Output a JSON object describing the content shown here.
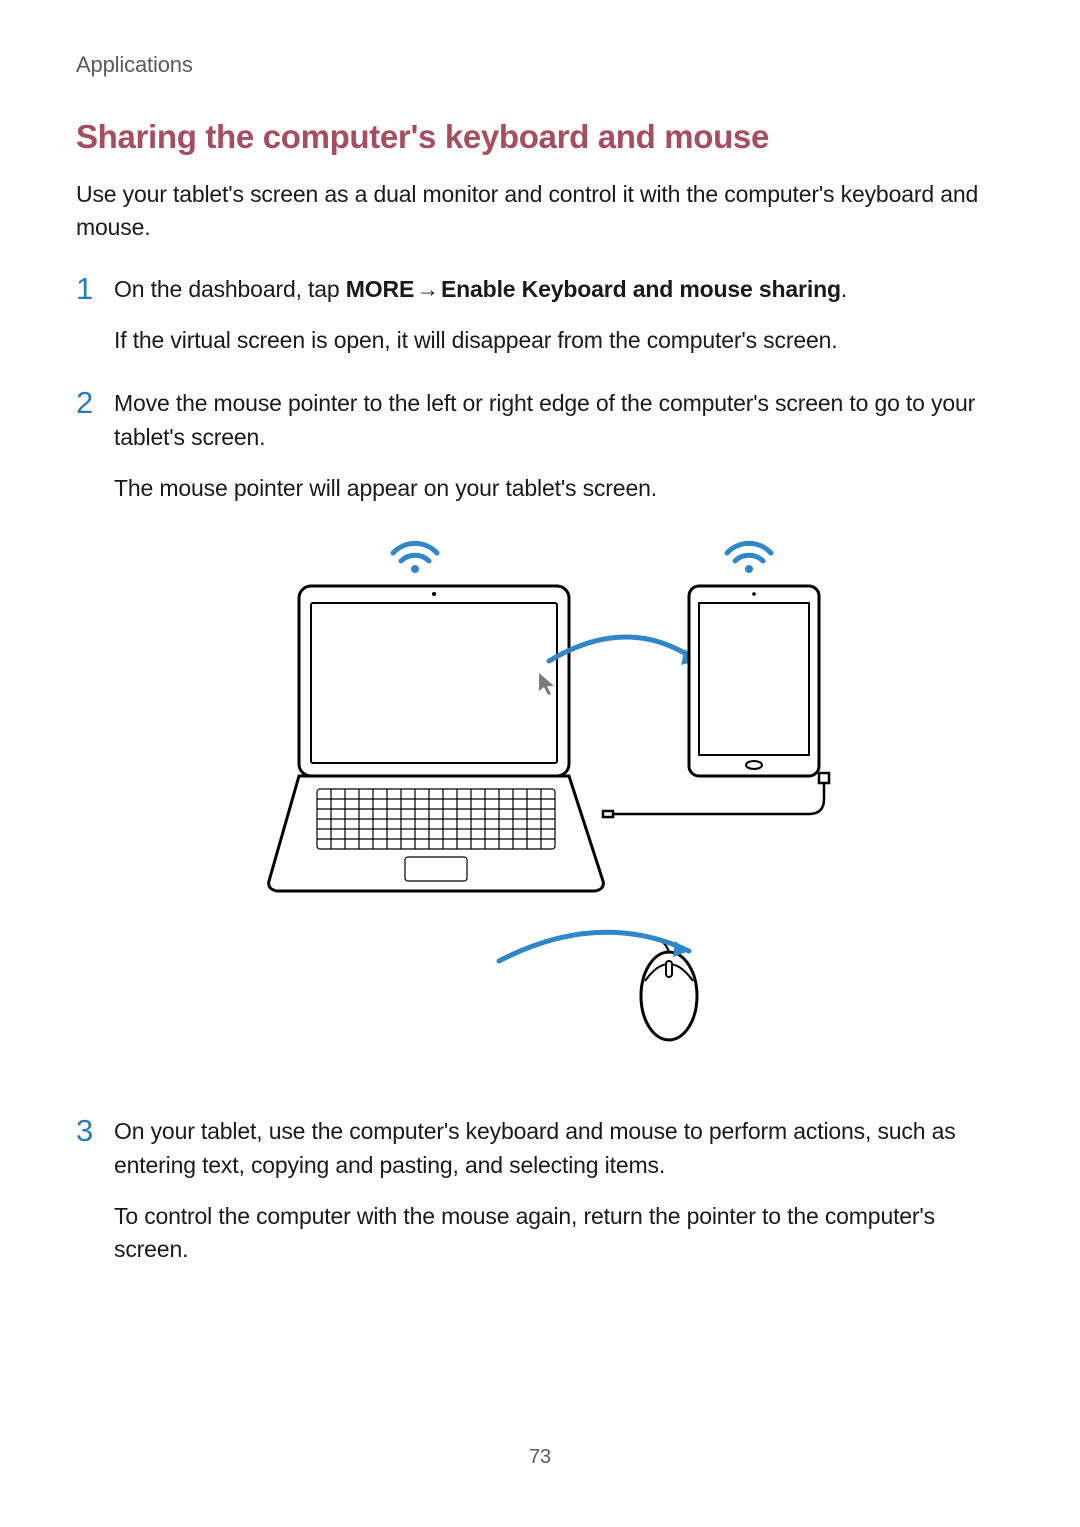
{
  "header": {
    "label": "Applications"
  },
  "section": {
    "title": "Sharing the computer's keyboard and mouse",
    "intro": "Use your tablet's screen as a dual monitor and control it with the computer's keyboard and mouse."
  },
  "steps": [
    {
      "num": "1",
      "line1_prefix": "On the dashboard, tap ",
      "line1_bold1": "MORE",
      "line1_arrow": " → ",
      "line1_bold2": "Enable Keyboard and mouse sharing",
      "line1_suffix": ".",
      "line2": "If the virtual screen is open, it will disappear from the computer's screen."
    },
    {
      "num": "2",
      "line1": "Move the mouse pointer to the left or right edge of the computer's screen to go to your tablet's screen.",
      "line2": "The mouse pointer will appear on your tablet's screen."
    },
    {
      "num": "3",
      "line1": "On your tablet, use the computer's keyboard and mouse to perform actions, such as entering text, copying and pasting, and selecting items.",
      "line2": "To control the computer with the mouse again, return the pointer to the computer's screen."
    }
  ],
  "page_number": "73"
}
